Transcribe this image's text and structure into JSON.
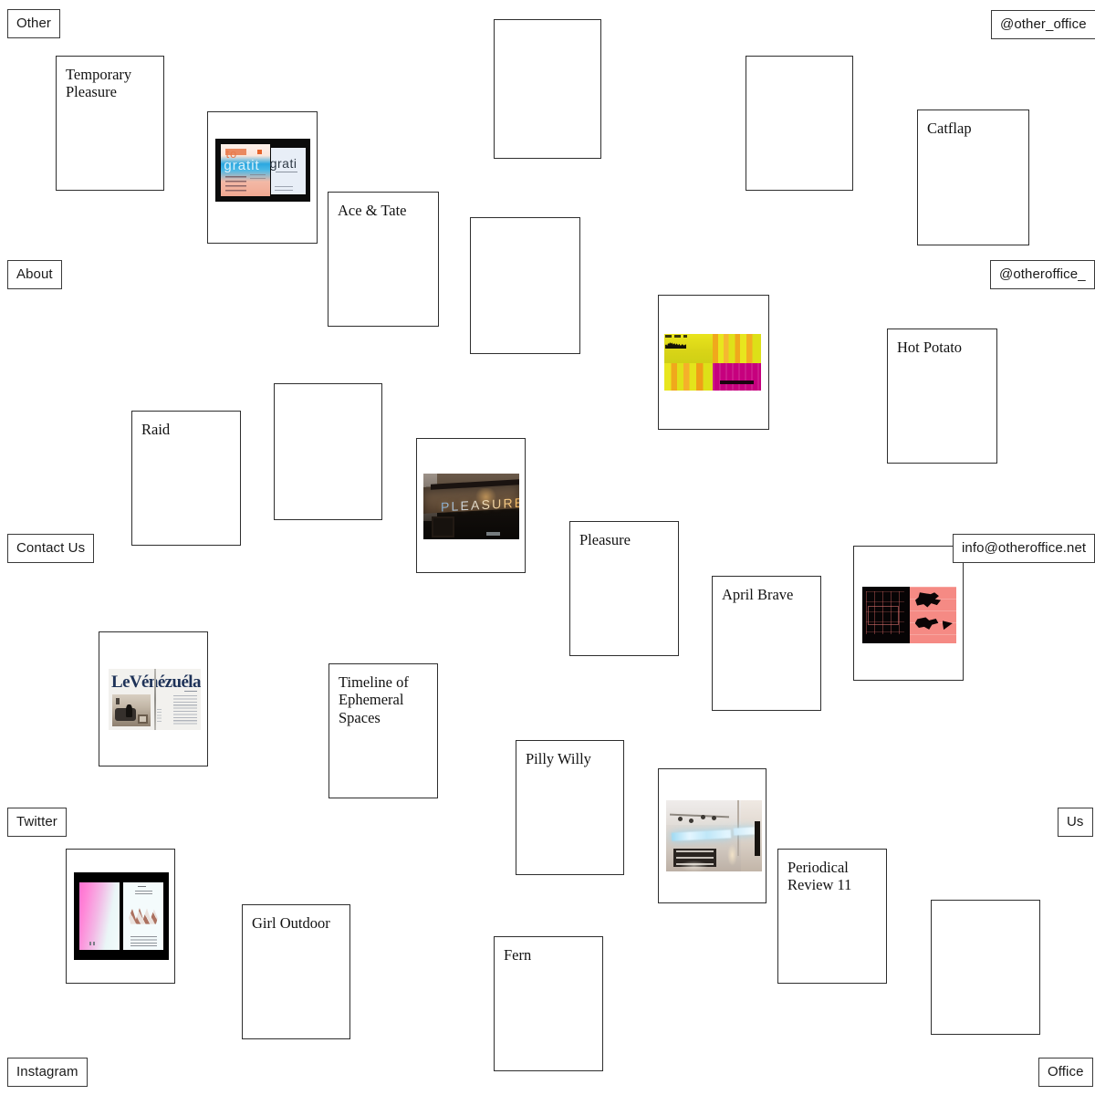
{
  "site": {
    "background_color": "#ffffff",
    "border_color": "#2e2e2e"
  },
  "nav": [
    {
      "id": "other",
      "label": "Other"
    },
    {
      "id": "other-office-handle",
      "label": "@other_office"
    },
    {
      "id": "about",
      "label": "About"
    },
    {
      "id": "otheroffice-handle",
      "label": "@otheroffice_"
    },
    {
      "id": "contact-us",
      "label": "Contact Us"
    },
    {
      "id": "email",
      "label": "info@otheroffice.net"
    },
    {
      "id": "twitter",
      "label": "Twitter"
    },
    {
      "id": "us",
      "label": "Us"
    },
    {
      "id": "instagram",
      "label": "Instagram"
    },
    {
      "id": "office",
      "label": "Office"
    }
  ],
  "projects": [
    {
      "id": "temporary-pleasure",
      "title": "Temporary\nPleasure",
      "thumb": null
    },
    {
      "id": "gratitude",
      "title": "",
      "thumb": "gratitude-poster-thumb"
    },
    {
      "id": "ace-and-tate",
      "title": "Ace & Tate",
      "thumb": null
    },
    {
      "id": "catflap",
      "title": "Catflap",
      "thumb": null
    },
    {
      "id": "yellow-poster",
      "title": "",
      "thumb": "yellow-magenta-poster-thumb"
    },
    {
      "id": "hot-potato",
      "title": "Hot Potato",
      "thumb": null
    },
    {
      "id": "raid",
      "title": "Raid",
      "thumb": null
    },
    {
      "id": "pleasure-sign",
      "title": "",
      "thumb": "pleasure-neon-sign-thumb"
    },
    {
      "id": "pleasure",
      "title": "Pleasure",
      "thumb": null
    },
    {
      "id": "april-brave",
      "title": "April Brave",
      "thumb": null
    },
    {
      "id": "salmon-spread",
      "title": "",
      "thumb": "salmon-black-spread-thumb"
    },
    {
      "id": "le-venezuela",
      "title": "",
      "thumb": "le-venezuela-spread-thumb"
    },
    {
      "id": "timeline-ephemeral",
      "title": "Timeline of\nEphemeral\nSpaces",
      "thumb": null
    },
    {
      "id": "pilly-willy",
      "title": "Pilly Willy",
      "thumb": null
    },
    {
      "id": "retail-neon",
      "title": "",
      "thumb": "retail-interior-neon-thumb"
    },
    {
      "id": "periodical-review-11",
      "title": "Periodical\nReview 11",
      "thumb": null
    },
    {
      "id": "pink-book",
      "title": "",
      "thumb": "pink-scribble-book-thumb"
    },
    {
      "id": "girl-outdoor",
      "title": "Girl Outdoor",
      "thumb": null
    },
    {
      "id": "fern",
      "title": "Fern",
      "thumb": null
    },
    {
      "id": "empty-top-center",
      "title": "",
      "thumb": null
    },
    {
      "id": "empty-top-right",
      "title": "",
      "thumb": null
    },
    {
      "id": "empty-upper-center",
      "title": "",
      "thumb": null
    },
    {
      "id": "empty-mid-left",
      "title": "",
      "thumb": null
    },
    {
      "id": "empty-bottom-right",
      "title": "",
      "thumb": null
    }
  ],
  "thumb_art": {
    "gratitude-poster-thumb": {
      "word_top": "to",
      "word_mid": "gratit",
      "word_right": "grati"
    },
    "pleasure-neon-sign-thumb": {
      "sign_text": "PLEASURE"
    },
    "le-venezuela-spread-thumb": {
      "masthead": "LeVénézuéla"
    }
  }
}
